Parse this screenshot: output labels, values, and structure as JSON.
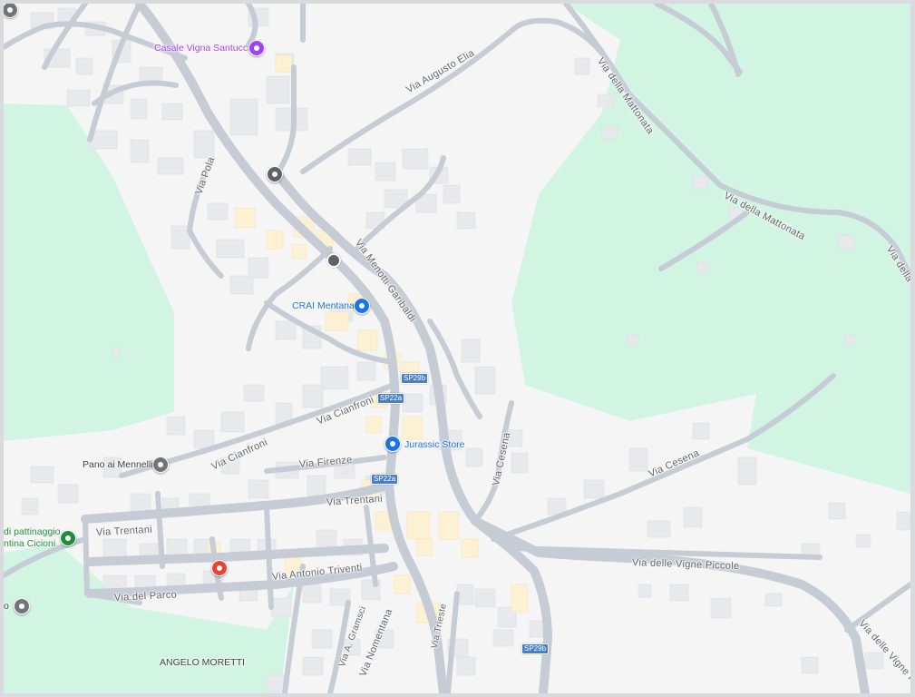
{
  "map": {
    "colors": {
      "land": "#f5f5f5",
      "park": "#d2f5e3",
      "road": "#c5ccd6",
      "building": "#e8e9ed",
      "highlight_building": "#fdf1d3",
      "shield": "#4a7ec8"
    },
    "streets": [
      "Via Augusto Elia",
      "Via della Mattonata",
      "Via della Mattonata",
      "Via della Mattonata",
      "Via Pola",
      "Via Menotti Garibaldi",
      "Via Cianfroni",
      "Via Cianfroni",
      "Via Firenze",
      "Via Cesena",
      "Via Cesena",
      "Via Trentani",
      "Via Trentani",
      "Via delle Vigne Piccole",
      "Via Antonio Triventi",
      "Via del Parco",
      "Via A. Gramsci",
      "Via Nomentana",
      "Via Trieste",
      "Via delle Vigne Picc"
    ],
    "pois": [
      {
        "name": "Casale Vigna Santucci",
        "icon": "home-icon",
        "color": "#a142f4"
      },
      {
        "name": "CRAI Mentana",
        "icon": "shopping-cart-icon",
        "color": "#1a73e8"
      },
      {
        "name": "Jurassic Store",
        "icon": "shopping-bag-icon",
        "color": "#1a73e8"
      },
      {
        "name": "Pano ai Mennelli",
        "icon": "place-icon",
        "color": "#70757a"
      },
      {
        "name": "di pattinaggio",
        "icon": "park-icon",
        "color": "#1e8e3e"
      },
      {
        "name": "ntina Cicioni",
        "icon": "",
        "color": "#1e8e3e"
      },
      {
        "name": "ANGELO MORETTI",
        "icon": "",
        "color": "#70757a"
      },
      {
        "name": "o",
        "icon": "place-icon",
        "color": "#70757a"
      }
    ],
    "unlabeled_pois": [
      {
        "icon": "school-icon",
        "color": "#5f6368"
      },
      {
        "icon": "bus-stop-icon",
        "color": "#5f6368"
      },
      {
        "icon": "hospital-icon",
        "color": "#ea4335"
      },
      {
        "icon": "place-icon",
        "color": "#70757a"
      }
    ],
    "shields": [
      "SP29b",
      "SP22a",
      "SP22a",
      "SP29b"
    ]
  }
}
